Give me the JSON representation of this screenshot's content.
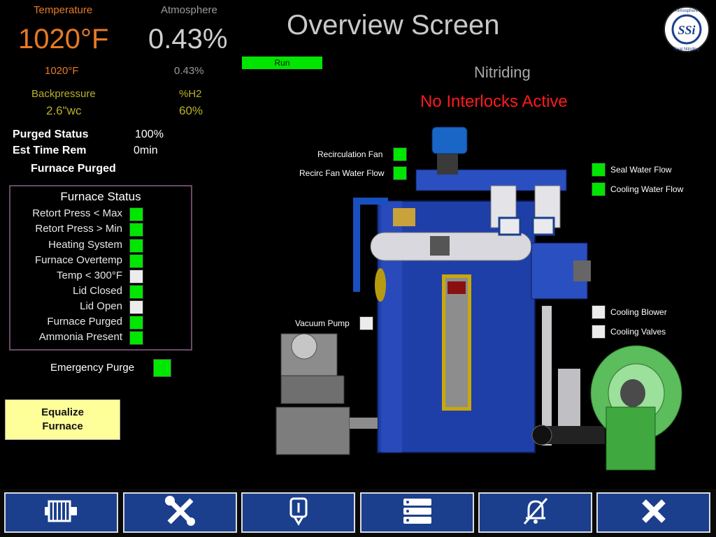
{
  "title": "Overview Screen",
  "process": {
    "temperature_label": "Temperature",
    "temperature_value": "1020°F",
    "temperature_setpoint": "1020°F",
    "atmosphere_label": "Atmosphere",
    "atmosphere_value": "0.43%",
    "atmosphere_setpoint": "0.43%",
    "backpressure_label": "Backpressure",
    "backpressure_value": "2.6\"wc",
    "h2_label": "%H2",
    "h2_value": "60%"
  },
  "run_label": "Run",
  "recipe": "Nitriding",
  "interlock_message": "No Interlocks Active",
  "purge": {
    "purged_status_label": "Purged Status",
    "purged_status_value": "100%",
    "est_time_label": "Est Time Rem",
    "est_time_value": "0min",
    "purged_text": "Furnace Purged"
  },
  "furnace_status": {
    "title": "Furnace Status",
    "items": [
      {
        "label": "Retort Press < Max",
        "state": "on"
      },
      {
        "label": "Retort Press > Min",
        "state": "on"
      },
      {
        "label": "Heating System",
        "state": "on"
      },
      {
        "label": "Furnace Overtemp",
        "state": "on"
      },
      {
        "label": "Temp < 300°F",
        "state": "off"
      },
      {
        "label": "Lid Closed",
        "state": "on"
      },
      {
        "label": "Lid Open",
        "state": "off"
      },
      {
        "label": "Furnace Purged",
        "state": "on"
      },
      {
        "label": "Ammonia Present",
        "state": "on"
      }
    ]
  },
  "emergency_purge_label": "Emergency Purge",
  "equalize_button": "Equalize Furnace",
  "indicators": {
    "recirc_fan": "Recirculation Fan",
    "recirc_water": "Recirc Fan Water Flow",
    "seal_water": "Seal Water Flow",
    "cooling_water": "Cooling Water Flow",
    "vacuum_pump": "Vacuum Pump",
    "cooling_blower": "Cooling Blower",
    "cooling_valves": "Cooling Valves"
  },
  "logo": {
    "text": "SSi",
    "ring_top": "Atmosphere",
    "ring_right": "Vacuum",
    "ring_bottom": "Seal Nitriding",
    "ring_side": "Sensors"
  },
  "colors": {
    "on": "#00e600",
    "off": "#ececec",
    "nav": "#1b3f8c",
    "alarm": "#ff1a1a",
    "equalize": "#ffff99"
  },
  "nav_icons": [
    "furnace-motor-icon",
    "tools-icon",
    "probe-icon",
    "data-list-icon",
    "alarm-silence-icon",
    "close-icon"
  ]
}
